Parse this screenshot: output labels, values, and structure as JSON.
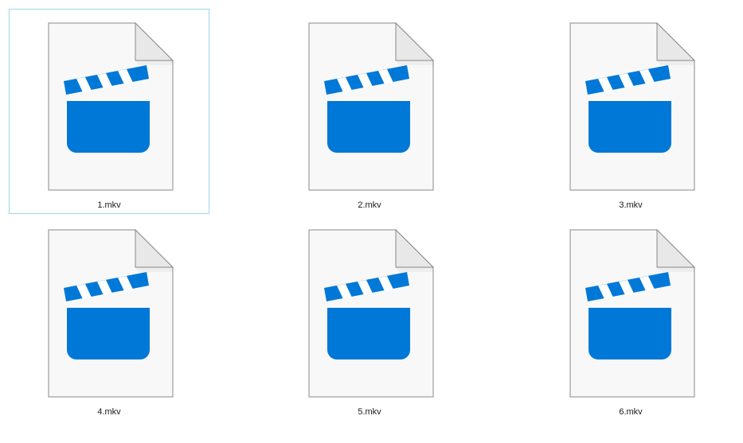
{
  "colors": {
    "accent": "#0078d7",
    "page_fill": "#f8f8f8",
    "page_border": "#8a8a8a",
    "focus_border": "#99d9ea"
  },
  "files": [
    {
      "name": "1.mkv",
      "icon": "video-file-icon",
      "focused": true
    },
    {
      "name": "2.mkv",
      "icon": "video-file-icon",
      "focused": false
    },
    {
      "name": "3.mkv",
      "icon": "video-file-icon",
      "focused": false
    },
    {
      "name": "4.mkv",
      "icon": "video-file-icon",
      "focused": false
    },
    {
      "name": "5.mkv",
      "icon": "video-file-icon",
      "focused": false
    },
    {
      "name": "6.mkv",
      "icon": "video-file-icon",
      "focused": false
    }
  ]
}
